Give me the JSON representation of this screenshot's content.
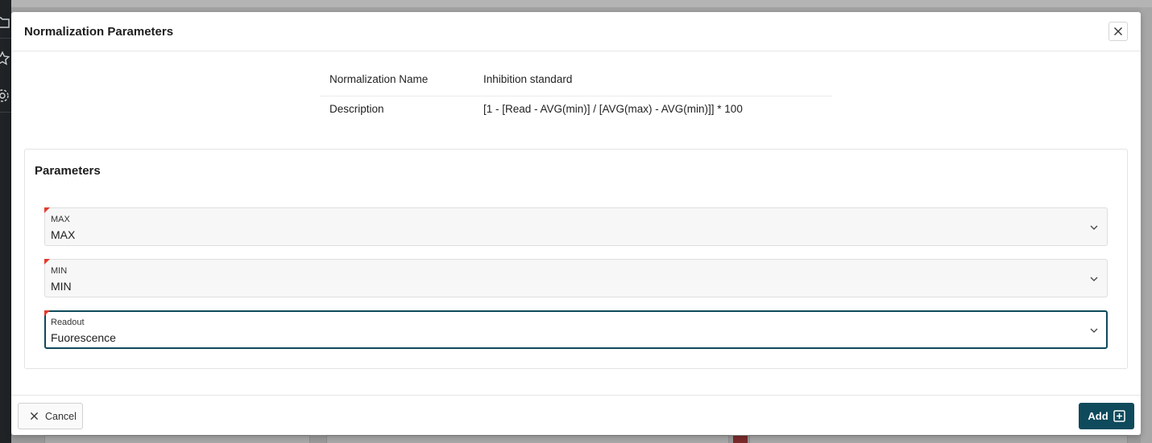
{
  "dialog": {
    "title": "Normalization Parameters",
    "close_icon": "close-icon"
  },
  "info": {
    "rows": [
      {
        "label": "Normalization Name",
        "value": "Inhibition standard"
      },
      {
        "label": "Description",
        "value": "[1 - [Read - AVG(min)] / [AVG(max) - AVG(min)]] * 100"
      }
    ]
  },
  "parameters": {
    "title": "Parameters",
    "fields": [
      {
        "label": "MAX",
        "value": "MAX",
        "required": true,
        "focused": false
      },
      {
        "label": "MIN",
        "value": "MIN",
        "required": true,
        "focused": false
      },
      {
        "label": "Readout",
        "value": "Fuorescence",
        "required": true,
        "focused": true
      }
    ]
  },
  "footer": {
    "cancel_label": "Cancel",
    "add_label": "Add"
  },
  "colors": {
    "primary": "#0e4a5c",
    "required": "#e53b2c"
  },
  "icons": {
    "background_nav": [
      "folder-icon",
      "star-icon",
      "gear-icon"
    ],
    "chevron": "chevron-down-icon",
    "cancel": "close-icon",
    "add": "plus-square-icon"
  }
}
